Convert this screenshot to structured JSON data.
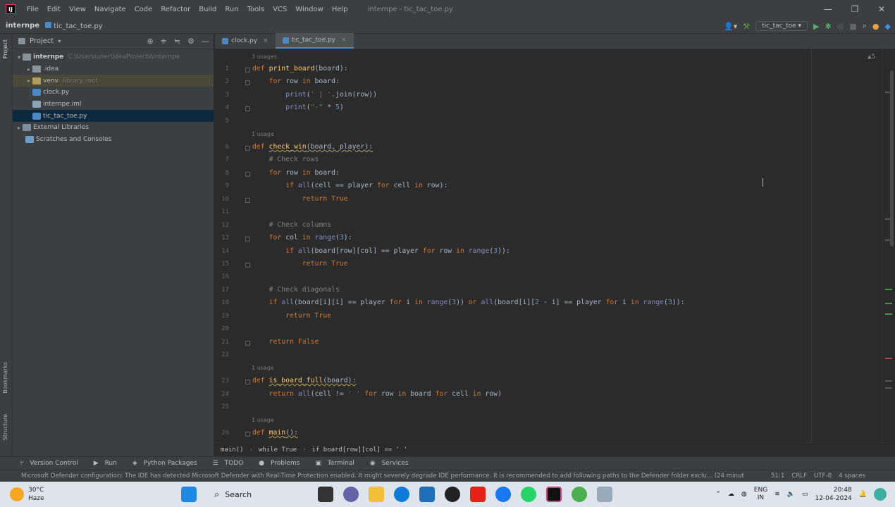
{
  "titlebar": {
    "menu": [
      "File",
      "Edit",
      "View",
      "Navigate",
      "Code",
      "Refactor",
      "Build",
      "Run",
      "Tools",
      "VCS",
      "Window",
      "Help"
    ],
    "window_title": "internpe - tic_tac_toe.py",
    "controls": [
      "—",
      "❐",
      "✕"
    ]
  },
  "navbar": {
    "project": "internpe",
    "file": "tic_tac_toe.py",
    "run_config": "tic_tac_toe"
  },
  "left_tool": {
    "project": "Project",
    "bookmarks": "Bookmarks",
    "structure": "Structure"
  },
  "project_panel": {
    "title": "Project",
    "tree": [
      {
        "name": "internpe",
        "path": "C:\\Users\\user\\IdeaProjects\\internpe",
        "kind": "root"
      },
      {
        "name": ".idea",
        "kind": "folder"
      },
      {
        "name": "venv",
        "path": "library root",
        "kind": "folder"
      },
      {
        "name": "clock.py",
        "kind": "py"
      },
      {
        "name": "internpe.iml",
        "kind": "iml"
      },
      {
        "name": "tic_tac_toe.py",
        "kind": "py",
        "selected": true
      },
      {
        "name": "External Libraries",
        "kind": "lib"
      },
      {
        "name": "Scratches and Consoles",
        "kind": "lib"
      }
    ]
  },
  "editor": {
    "tabs": [
      {
        "label": "clock.py",
        "active": false
      },
      {
        "label": "tic_tac_toe.py",
        "active": true
      }
    ],
    "inspection": "▲5",
    "hints": [
      "3 usages",
      "1 usage",
      "1 usage",
      "1 usage"
    ],
    "lines": [
      "1",
      "2",
      "3",
      "4",
      "5",
      "6",
      "7",
      "8",
      "9",
      "10",
      "11",
      "12",
      "13",
      "14",
      "15",
      "16",
      "17",
      "18",
      "19",
      "20",
      "21",
      "22",
      "23",
      "24",
      "25",
      "26"
    ]
  },
  "breadcrumb": [
    "main()",
    "while True",
    "if board[row][col] == ' '"
  ],
  "tool_windows": [
    "Version Control",
    "Run",
    "Python Packages",
    "TODO",
    "Problems",
    "Terminal",
    "Services"
  ],
  "status": {
    "message": "Microsoft Defender configuration: The IDE has detected Microsoft Defender with Real-Time Protection enabled. It might severely degrade IDE performance. It is recommended to add following paths to the Defender folder exclu... (24 minut",
    "position": "51:1",
    "line_sep": "CRLF",
    "encoding": "UTF-8",
    "indent": "4 spaces"
  },
  "taskbar": {
    "temp": "30°C",
    "weather": "Haze",
    "search": "Search",
    "lang1": "ENG",
    "lang2": "IN",
    "time": "20:48",
    "date": "12-04-2024"
  },
  "colors": {
    "bg": "#2b2b2b",
    "panel": "#3c3f41",
    "keyword": "#cc7832",
    "function": "#ffc66d",
    "string": "#6a8759",
    "number": "#6897bb",
    "comment": "#808080",
    "builtin": "#8888c6",
    "selection": "#0d293e"
  }
}
